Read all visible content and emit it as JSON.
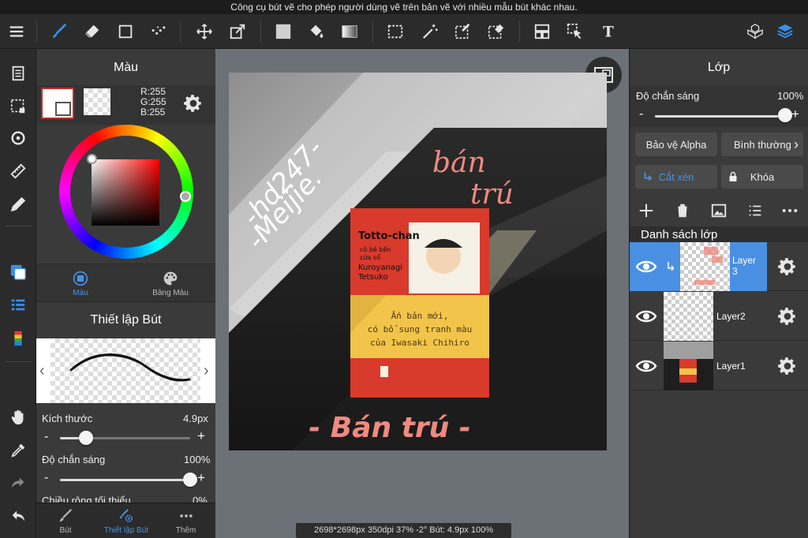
{
  "tooltip": "Công cụ bút vẽ cho phép người dùng vẽ trên bản vẽ với nhiều mẫu bút khác nhau.",
  "color_panel": {
    "title": "Màu",
    "rgb": {
      "r": "R:255",
      "g": "G:255",
      "b": "B:255"
    },
    "tabs": [
      {
        "label": "Màu"
      },
      {
        "label": "Bảng Màu"
      }
    ]
  },
  "brush_panel": {
    "title": "Thiết lập Bút",
    "size": {
      "label": "Kích thước",
      "value": "4.9px",
      "level": 0.2
    },
    "opacity": {
      "label": "Độ chắn sáng",
      "value": "100%",
      "level": 1.0
    },
    "min_width": {
      "label": "Chiều rộng tối thiểu",
      "value": "0%"
    }
  },
  "bottom_tabs": [
    {
      "label": "Bút"
    },
    {
      "label": "Thiết lập Bút"
    },
    {
      "label": "Thêm"
    }
  ],
  "status": "2698*2698px 350dpi 37% -2° Bút: 4.9px 100%",
  "layer_panel": {
    "title": "Lớp",
    "opacity_label": "Độ chắn sáng",
    "opacity_value": "100%",
    "opacity_level": 1.0,
    "protect_alpha": "Bảo vệ Alpha",
    "blend_mode": "Bình thường",
    "clipping": "Cắt xén",
    "lock": "Khóa",
    "list_title": "Danh sách lớp",
    "layers": [
      {
        "name": "Layer\n3"
      },
      {
        "name": "Layer2"
      },
      {
        "name": "Layer1"
      }
    ]
  },
  "artwork": {
    "text_handle": "-hd247-",
    "text_handle2": "-Meijie.",
    "text_title_a": "bán",
    "text_title_b": "trú",
    "text_bottom": "- Bán trú -",
    "book_title": "Totto-chan",
    "book_sub1": "cô bé bên",
    "book_sub2": "cửa sổ",
    "book_author": "Kuroyanagi",
    "book_author2": "Tetsuko",
    "band_line1": "Ấn bản mới,",
    "band_line2": "có bổ sung tranh màu",
    "band_line3": "của Iwasaki Chihiro"
  },
  "colors": {
    "accent": "#3a8ee6",
    "active_layer": "#4a90e2",
    "panel": "#3a3a3a",
    "canvas_bg": "#6c7077"
  }
}
